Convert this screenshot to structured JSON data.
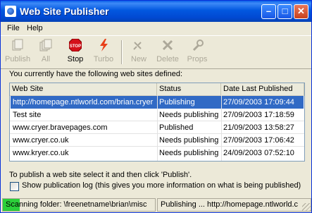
{
  "window": {
    "title": "Web Site Publisher"
  },
  "menu": {
    "file": "File",
    "help": "Help"
  },
  "toolbar": {
    "publish": "Publish",
    "all": "All",
    "stop": "Stop",
    "turbo": "Turbo",
    "new": "New",
    "delete": "Delete",
    "props": "Props"
  },
  "intro_text": "You currently have the following web sites defined:",
  "table": {
    "headers": [
      "Web Site",
      "Status",
      "Date Last Published"
    ],
    "rows": [
      {
        "site": "http://homepage.ntlworld.com/brian.cryer",
        "status": "Publishing",
        "date": "27/09/2003 17:09:44"
      },
      {
        "site": "Test site",
        "status": "Needs publishing",
        "date": "27/09/2003 17:18:59"
      },
      {
        "site": "www.cryer.bravepages.com",
        "status": "Published",
        "date": "21/09/2003 13:58:27"
      },
      {
        "site": "www.cryer.co.uk",
        "status": "Needs publishing",
        "date": "27/09/2003 17:06:42"
      },
      {
        "site": "www.kryer.co.uk",
        "status": "Needs publishing",
        "date": "24/09/2003 07:52:10"
      }
    ]
  },
  "instructions": "To publish a web site select it and then click 'Publish'.",
  "show_log_label": "Show publication log (this gives you more information on what is being published)",
  "status": {
    "left": "Scanning folder: \\freenetname\\brian\\misc",
    "right": "Publishing ... http://homepage.ntlworld.c",
    "progress": 0.11
  },
  "colors": {
    "selection": "#316ac5",
    "progress": "#2bd03a",
    "title_bar": "#0258e0"
  }
}
